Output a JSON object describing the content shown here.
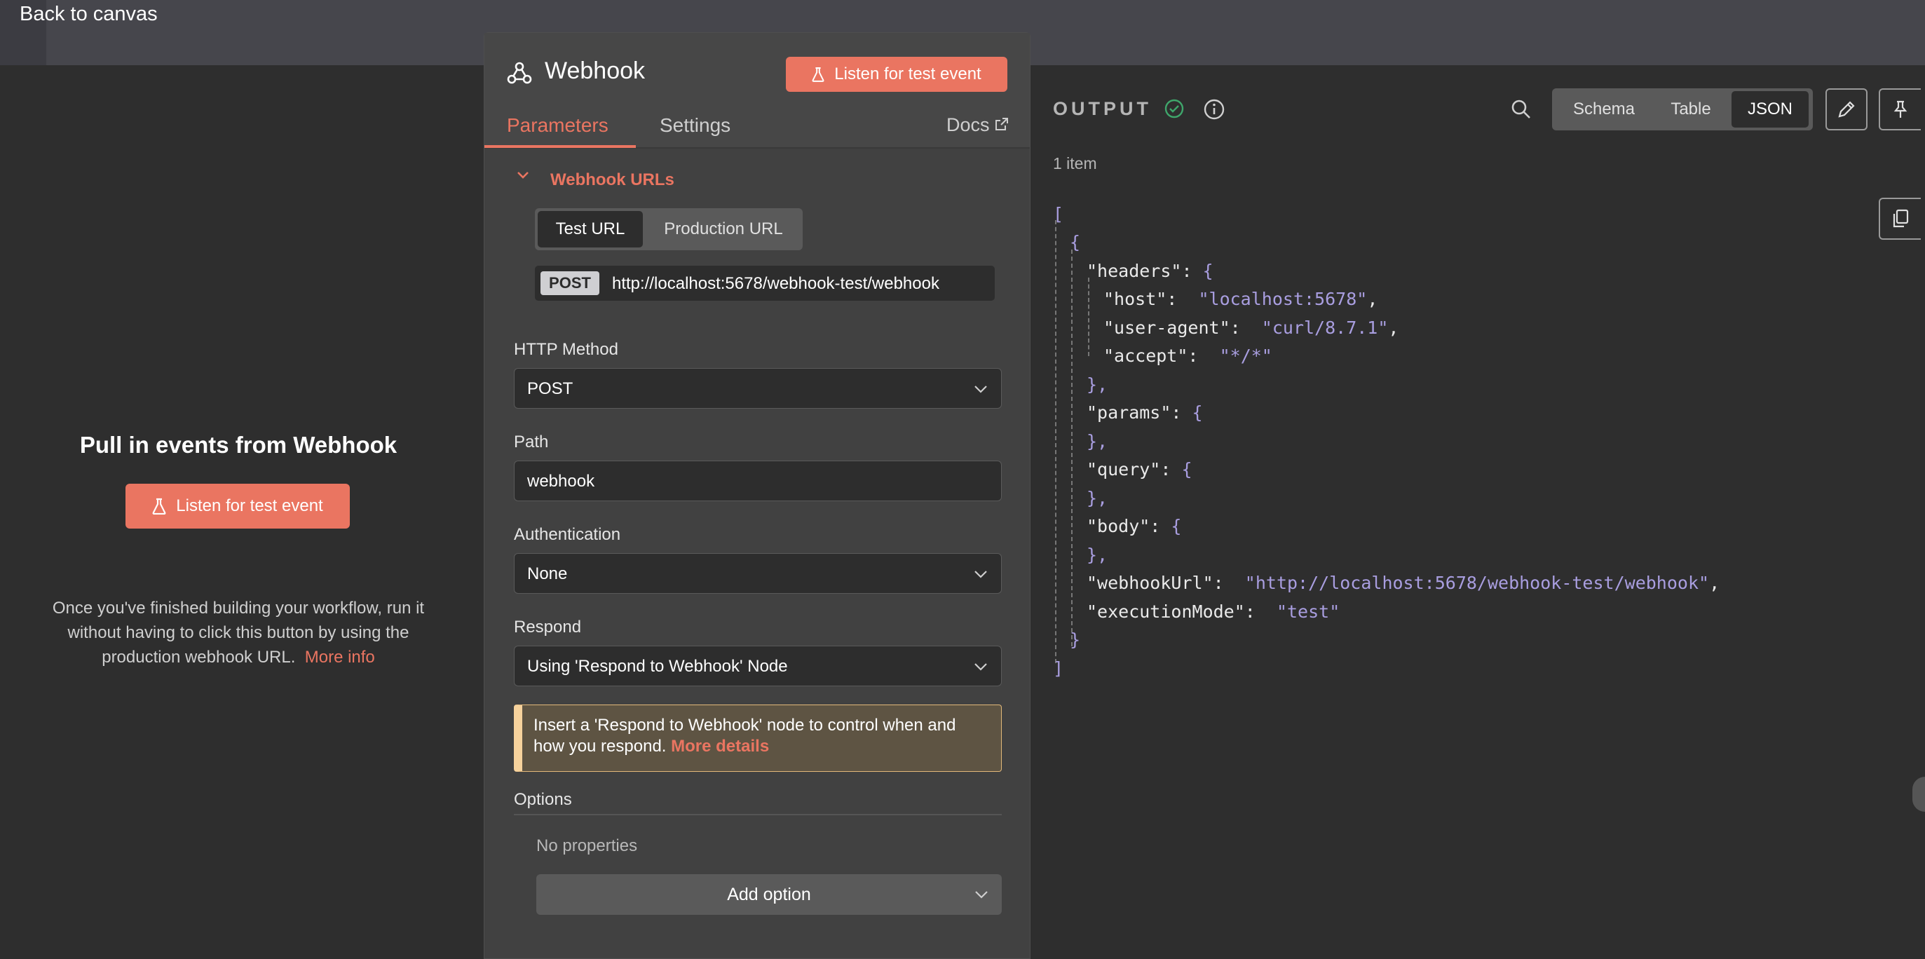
{
  "topbar": {
    "back_label": "Back to canvas"
  },
  "left": {
    "title": "Pull in events from Webhook",
    "listen_button": "Listen for test event",
    "description": "Once you've finished building your workflow, run it without having to click this button by using the production webhook URL.",
    "more_info": "More info"
  },
  "node": {
    "title": "Webhook",
    "listen_button": "Listen for test event",
    "tabs": {
      "parameters": "Parameters",
      "settings": "Settings",
      "docs": "Docs"
    },
    "webhook_urls": {
      "section_title": "Webhook URLs",
      "test_url_tab": "Test URL",
      "production_url_tab": "Production URL",
      "method_badge": "POST",
      "url": "http://localhost:5678/webhook-test/webhook"
    },
    "http_method": {
      "label": "HTTP Method",
      "value": "POST"
    },
    "path": {
      "label": "Path",
      "value": "webhook"
    },
    "authentication": {
      "label": "Authentication",
      "value": "None"
    },
    "respond": {
      "label": "Respond",
      "value": "Using 'Respond to Webhook' Node"
    },
    "notice": {
      "text": "Insert a 'Respond to Webhook' node to control when and how you respond.",
      "link": "More details"
    },
    "options": {
      "label": "Options",
      "empty": "No properties",
      "add_button": "Add option"
    }
  },
  "output": {
    "title": "OUTPUT",
    "views": {
      "schema": "Schema",
      "table": "Table",
      "json": "JSON",
      "selected": "JSON"
    },
    "item_count": "1 item",
    "json": {
      "headers": {
        "host": "localhost:5678",
        "user-agent": "curl/8.7.1",
        "accept": "*/*"
      },
      "webhookUrl": "http://localhost:5678/webhook-test/webhook",
      "executionMode": "test"
    }
  },
  "colors": {
    "accent": "#ea7561",
    "json_string": "#a99ee0",
    "success": "#3fa66b"
  }
}
